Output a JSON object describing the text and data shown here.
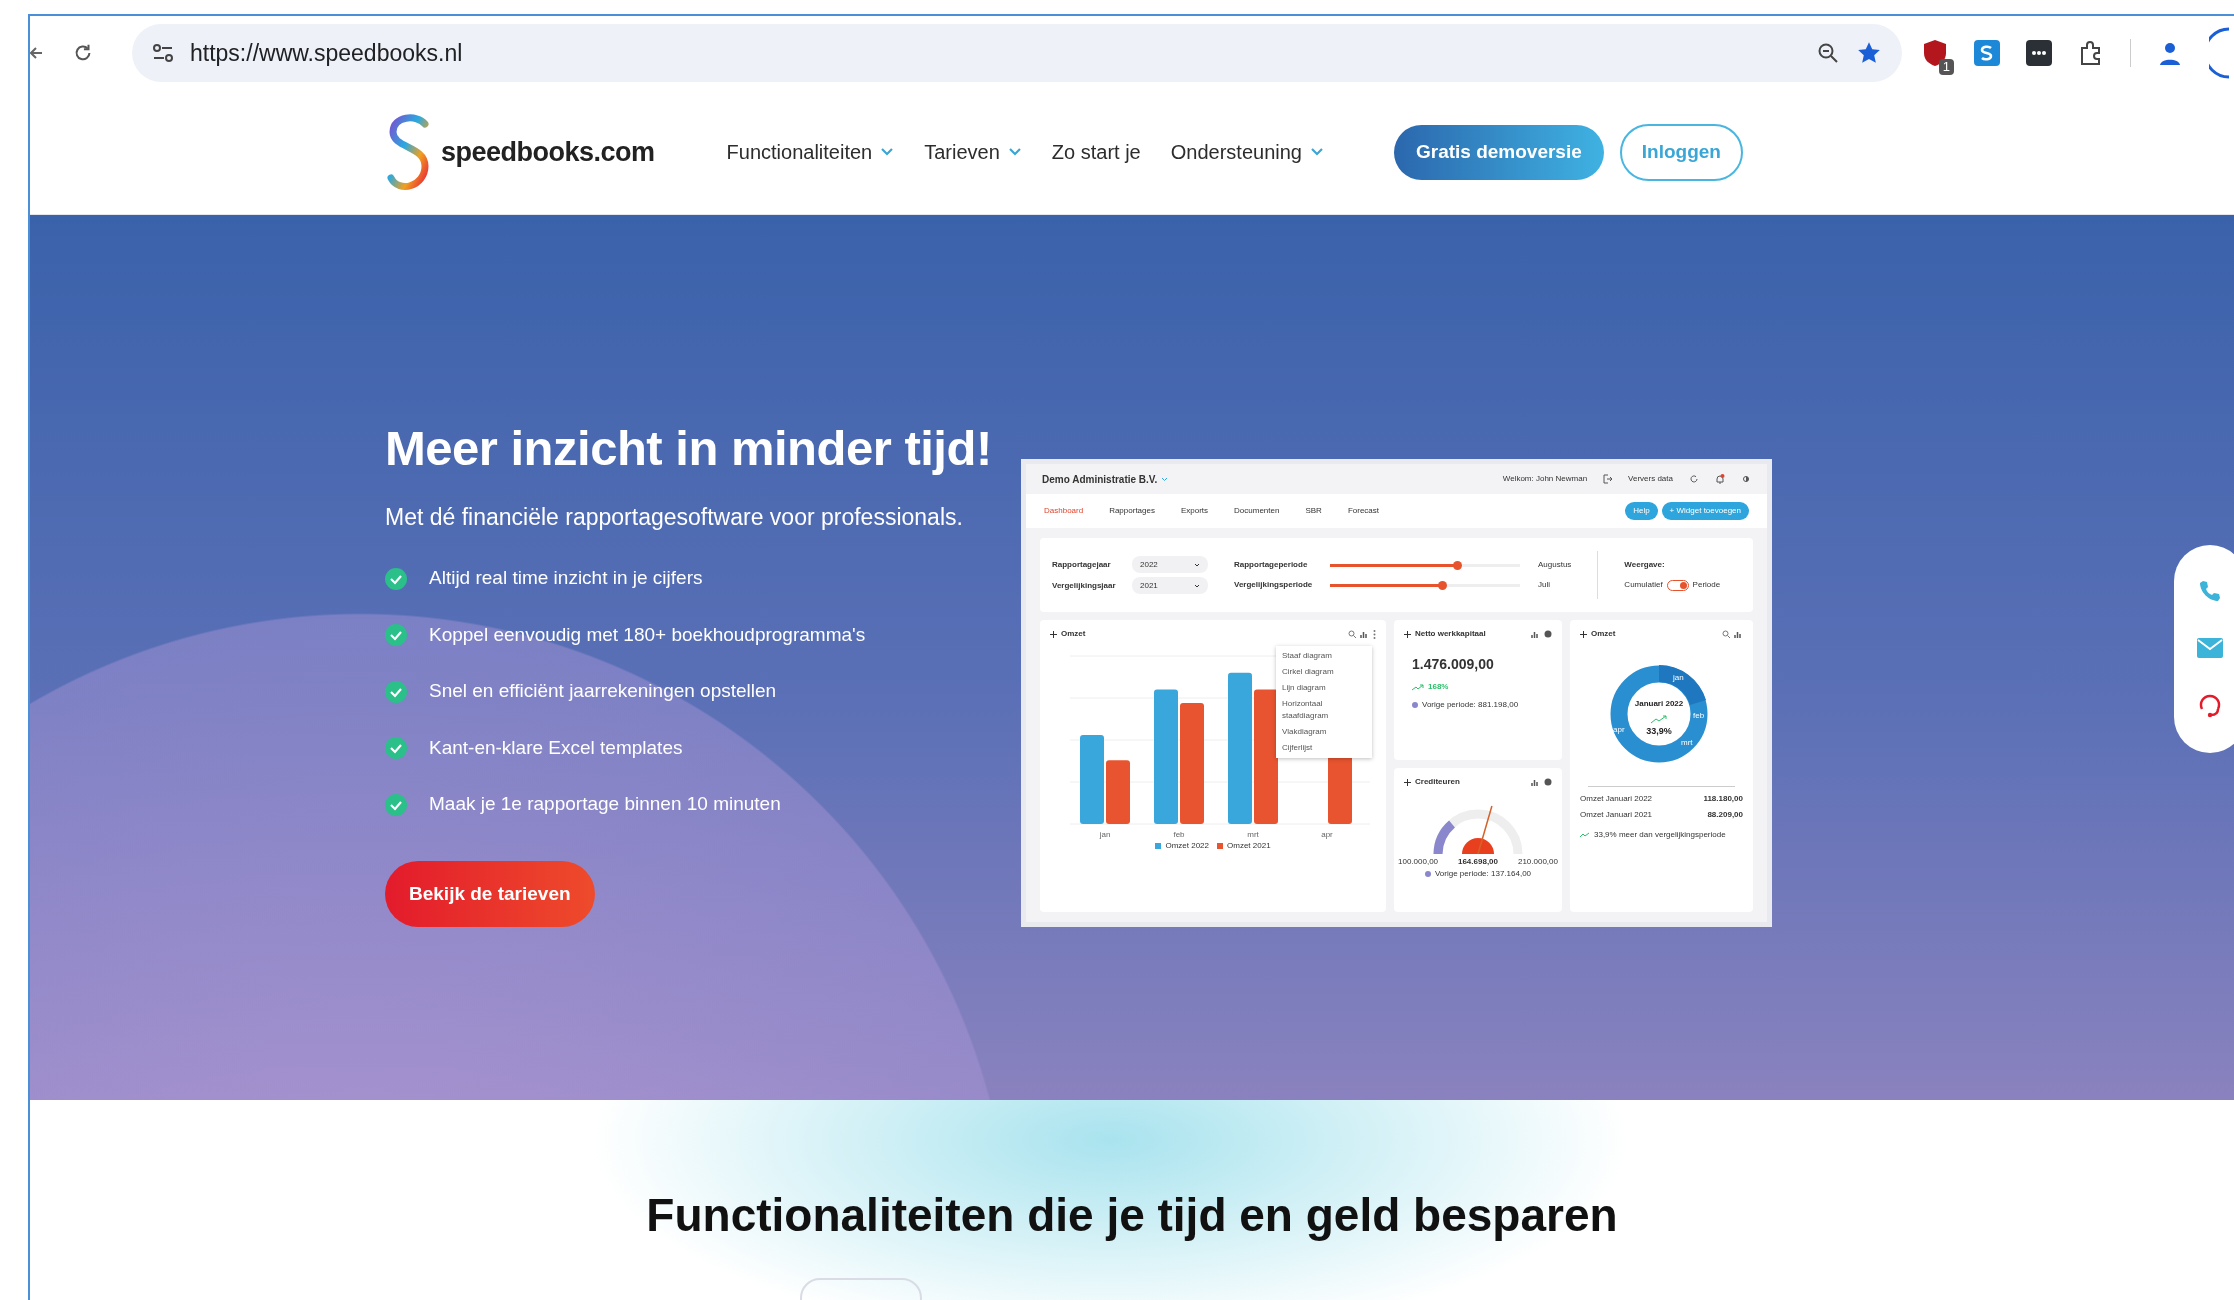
{
  "browser": {
    "url": "https://www.speedbooks.nl",
    "extension_badge": "1"
  },
  "site": {
    "logo_text": "speedbooks.com",
    "nav": [
      {
        "label": "Functionaliteiten",
        "dropdown": true
      },
      {
        "label": "Tarieven",
        "dropdown": true
      },
      {
        "label": "Zo start je",
        "dropdown": false
      },
      {
        "label": "Ondersteuning",
        "dropdown": true
      }
    ],
    "demo_button": "Gratis demoversie",
    "login_button": "Inloggen"
  },
  "hero": {
    "title": "Meer inzicht in minder tijd!",
    "subtitle": "Met dé financiële rapportagesoftware voor professionals.",
    "features": [
      "Altijd real time inzicht in je cijfers",
      "Koppel eenvoudig met 180+ boekhoudprogramma's",
      "Snel en efficiënt jaarrekeningen opstellen",
      "Kant-en-klare Excel templates",
      "Maak je 1e rapportage binnen 10 minuten"
    ],
    "cta": "Bekijk de tarieven"
  },
  "dashboard": {
    "company": "Demo Administratie B.V.",
    "welcome": "Welkom: John Newman",
    "refresh": "Ververs data",
    "tabs": [
      {
        "label": "Dashboard",
        "selected": true
      },
      {
        "label": "Rapportages",
        "selected": false
      },
      {
        "label": "Exports",
        "selected": false
      },
      {
        "label": "Documenten",
        "selected": false
      },
      {
        "label": "SBR",
        "selected": false
      },
      {
        "label": "Forecast",
        "selected": false
      }
    ],
    "help_button": "Help",
    "add_widget_button": "+ Widget toevoegen",
    "years": [
      {
        "label": "Rapportagejaar",
        "value": "2022"
      },
      {
        "label": "Vergelijkingsjaar",
        "value": "2021"
      }
    ],
    "periods": [
      {
        "label": "Rapportageperiode",
        "level": 0.67,
        "value": "Augustus"
      },
      {
        "label": "Vergelijkingsperiode",
        "level": 0.59,
        "value": "Juli"
      }
    ],
    "view": {
      "label": "Weergave:",
      "off_label": "Cumulatief",
      "on_label": "Periode",
      "on": true
    },
    "bar_widget": {
      "title": "Omzet",
      "x_labels": [
        "jan",
        "feb",
        "mrt",
        "apr"
      ],
      "legend": [
        {
          "name": "Omzet 2022",
          "color": "#39a6dc"
        },
        {
          "name": "Omzet 2021",
          "color": "#e8542f"
        }
      ],
      "menu": [
        "Staaf diagram",
        "Cirkel diagram",
        "Lijn diagram",
        "Horizontaal staafdiagram",
        "Vlakdiagram",
        "Cijferlijst"
      ]
    },
    "kpi_widget": {
      "title": "Netto werkkapitaal",
      "value": "1.476.009,00",
      "change": "168%",
      "previous": "Vorige periode: 881.198,00"
    },
    "gauge_widget": {
      "title": "Crediteuren",
      "min": "100.000,00",
      "value": "164.698,00",
      "max": "210.000,00",
      "level": 0.59,
      "previous": "Vorige periode: 137.164,00"
    },
    "donut_widget": {
      "title": "Omzet",
      "center_title": "Januari 2022",
      "center_value": "33,9%",
      "segments": [
        "jan",
        "feb",
        "mrt",
        "apr"
      ],
      "rows": [
        {
          "label": "Omzet Januari 2022",
          "value": "118.180,00"
        },
        {
          "label": "Omzet Januari 2021",
          "value": "88.209,00"
        }
      ],
      "note": "33,9% meer dan vergelijkingsperiode"
    }
  },
  "section": {
    "title": "Functionaliteiten die je tijd en geld besparen"
  }
}
